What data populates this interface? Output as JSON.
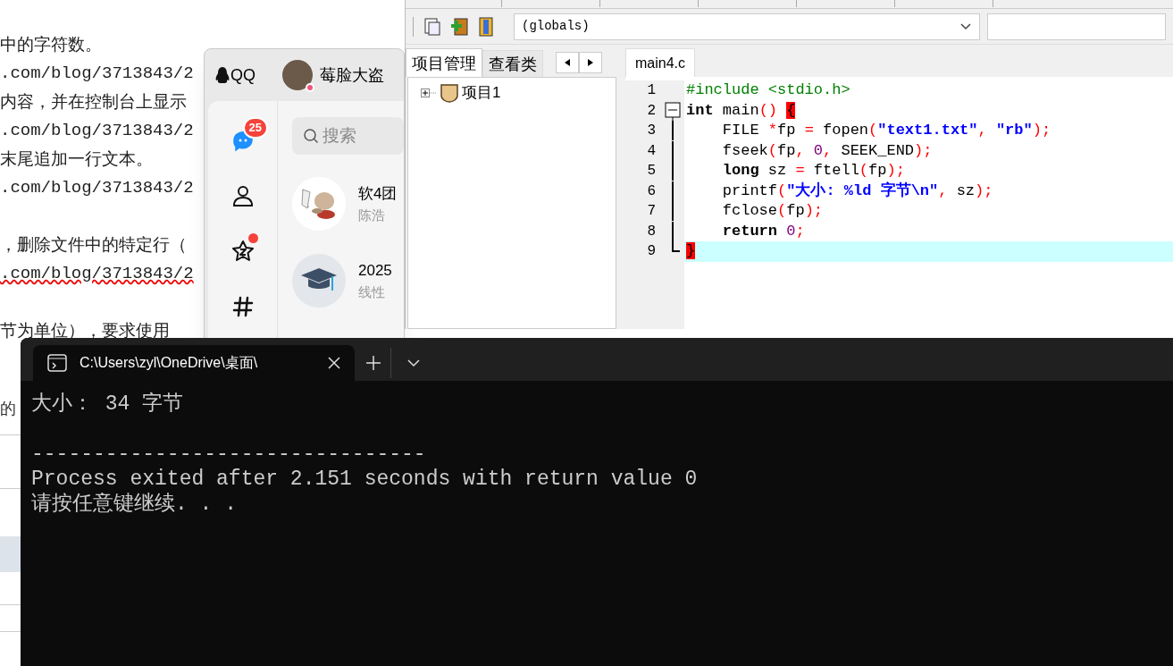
{
  "document": {
    "lines": [
      {
        "kind": "text",
        "text": "中的字符数。"
      },
      {
        "kind": "link",
        "text": ".com/blog/3713843/2"
      },
      {
        "kind": "text",
        "text": "内容，并在控制台上显示"
      },
      {
        "kind": "link",
        "text": ".com/blog/3713843/2"
      },
      {
        "kind": "text",
        "text": "末尾追加一行文本。"
      },
      {
        "kind": "link",
        "text": ".com/blog/3713843/2"
      },
      {
        "kind": "gap"
      },
      {
        "kind": "text",
        "text": "，删除文件中的特定行（"
      },
      {
        "kind": "link",
        "text": ".com/blog/3713843/2",
        "misspelled": true
      },
      {
        "kind": "gap"
      },
      {
        "kind": "text",
        "text": "节为单位），要求使用"
      }
    ],
    "side_text": "的"
  },
  "qq": {
    "app_name": "QQ",
    "user_name": "莓脸大盗",
    "nav": [
      {
        "kind": "chat",
        "selected": true,
        "badge": "25"
      },
      {
        "kind": "contacts",
        "selected": false
      },
      {
        "kind": "favorites",
        "selected": false,
        "unread_dot": true
      },
      {
        "kind": "channels",
        "selected": false
      }
    ],
    "search": {
      "placeholder": "搜索"
    },
    "chats": [
      {
        "kind": "picture",
        "name": "软4团",
        "preview": "陈浩"
      },
      {
        "kind": "cap",
        "name": "2025",
        "preview": "线性"
      }
    ]
  },
  "devcpp": {
    "scope": "(globals)",
    "panel_tabs": [
      {
        "label": "项目管理",
        "selected": true
      },
      {
        "label": "查看类",
        "selected": false
      }
    ],
    "tree": [
      {
        "label": "项目1",
        "expanded": false
      }
    ],
    "editor_tabs": [
      {
        "label": "main4.c",
        "selected": true
      }
    ],
    "lines": [
      {
        "number": "1",
        "kind": "plain",
        "current": false,
        "tokens": [
          {
            "kind": "preproc",
            "text": "#include <stdio.h>"
          }
        ]
      },
      {
        "number": "2",
        "kind": "fold-start",
        "current": false,
        "tokens": [
          {
            "kind": "keyword",
            "text": "int"
          },
          {
            "kind": "plain",
            "text": " main"
          },
          {
            "kind": "punct",
            "text": "() "
          },
          {
            "kind": "brace",
            "text": "{"
          }
        ]
      },
      {
        "number": "3",
        "kind": "fold-body",
        "current": false,
        "tokens": [
          {
            "kind": "plain",
            "text": "    FILE "
          },
          {
            "kind": "punct",
            "text": "*"
          },
          {
            "kind": "plain",
            "text": "fp "
          },
          {
            "kind": "punct",
            "text": "="
          },
          {
            "kind": "plain",
            "text": " fopen"
          },
          {
            "kind": "punct",
            "text": "("
          },
          {
            "kind": "string",
            "text": "\"text1.txt\""
          },
          {
            "kind": "punct",
            "text": ","
          },
          {
            "kind": "string",
            "text": " \"rb\""
          },
          {
            "kind": "punct",
            "text": ");"
          }
        ]
      },
      {
        "number": "4",
        "kind": "fold-body",
        "current": false,
        "tokens": [
          {
            "kind": "plain",
            "text": "    fseek"
          },
          {
            "kind": "punct",
            "text": "("
          },
          {
            "kind": "plain",
            "text": "fp"
          },
          {
            "kind": "punct",
            "text": ", "
          },
          {
            "kind": "number",
            "text": "0"
          },
          {
            "kind": "punct",
            "text": ","
          },
          {
            "kind": "plain",
            "text": " SEEK_END"
          },
          {
            "kind": "punct",
            "text": ");"
          }
        ]
      },
      {
        "number": "5",
        "kind": "fold-body",
        "current": false,
        "tokens": [
          {
            "kind": "keyword",
            "text": "    long"
          },
          {
            "kind": "plain",
            "text": " sz "
          },
          {
            "kind": "punct",
            "text": "="
          },
          {
            "kind": "plain",
            "text": " ftell"
          },
          {
            "kind": "punct",
            "text": "("
          },
          {
            "kind": "plain",
            "text": "fp"
          },
          {
            "kind": "punct",
            "text": ");"
          }
        ]
      },
      {
        "number": "6",
        "kind": "fold-body",
        "current": false,
        "tokens": [
          {
            "kind": "plain",
            "text": "    printf"
          },
          {
            "kind": "punct",
            "text": "("
          },
          {
            "kind": "string",
            "text": "\"大小: %ld 字节\\n\""
          },
          {
            "kind": "punct",
            "text": ","
          },
          {
            "kind": "plain",
            "text": " sz"
          },
          {
            "kind": "punct",
            "text": ");"
          }
        ]
      },
      {
        "number": "7",
        "kind": "fold-body",
        "current": false,
        "tokens": [
          {
            "kind": "plain",
            "text": "    fclose"
          },
          {
            "kind": "punct",
            "text": "("
          },
          {
            "kind": "plain",
            "text": "fp"
          },
          {
            "kind": "punct",
            "text": ");"
          }
        ]
      },
      {
        "number": "8",
        "kind": "fold-body",
        "current": false,
        "tokens": [
          {
            "kind": "keyword",
            "text": "    return "
          },
          {
            "kind": "number",
            "text": "0"
          },
          {
            "kind": "punct",
            "text": ";"
          }
        ]
      },
      {
        "number": "9",
        "kind": "fold-end",
        "current": true,
        "tokens": [
          {
            "kind": "brace",
            "text": "}"
          }
        ]
      }
    ]
  },
  "terminal": {
    "tab_title": "C:\\Users\\zyl\\OneDrive\\桌面\\",
    "output": [
      {
        "kind": "text",
        "text": "大小： 34 字节"
      },
      {
        "kind": "rule",
        "text": "--------------------------------"
      },
      {
        "kind": "text",
        "text": "Process exited after 2.151 seconds with return value 0"
      },
      {
        "kind": "text",
        "text": "请按任意键继续. . ."
      }
    ]
  }
}
